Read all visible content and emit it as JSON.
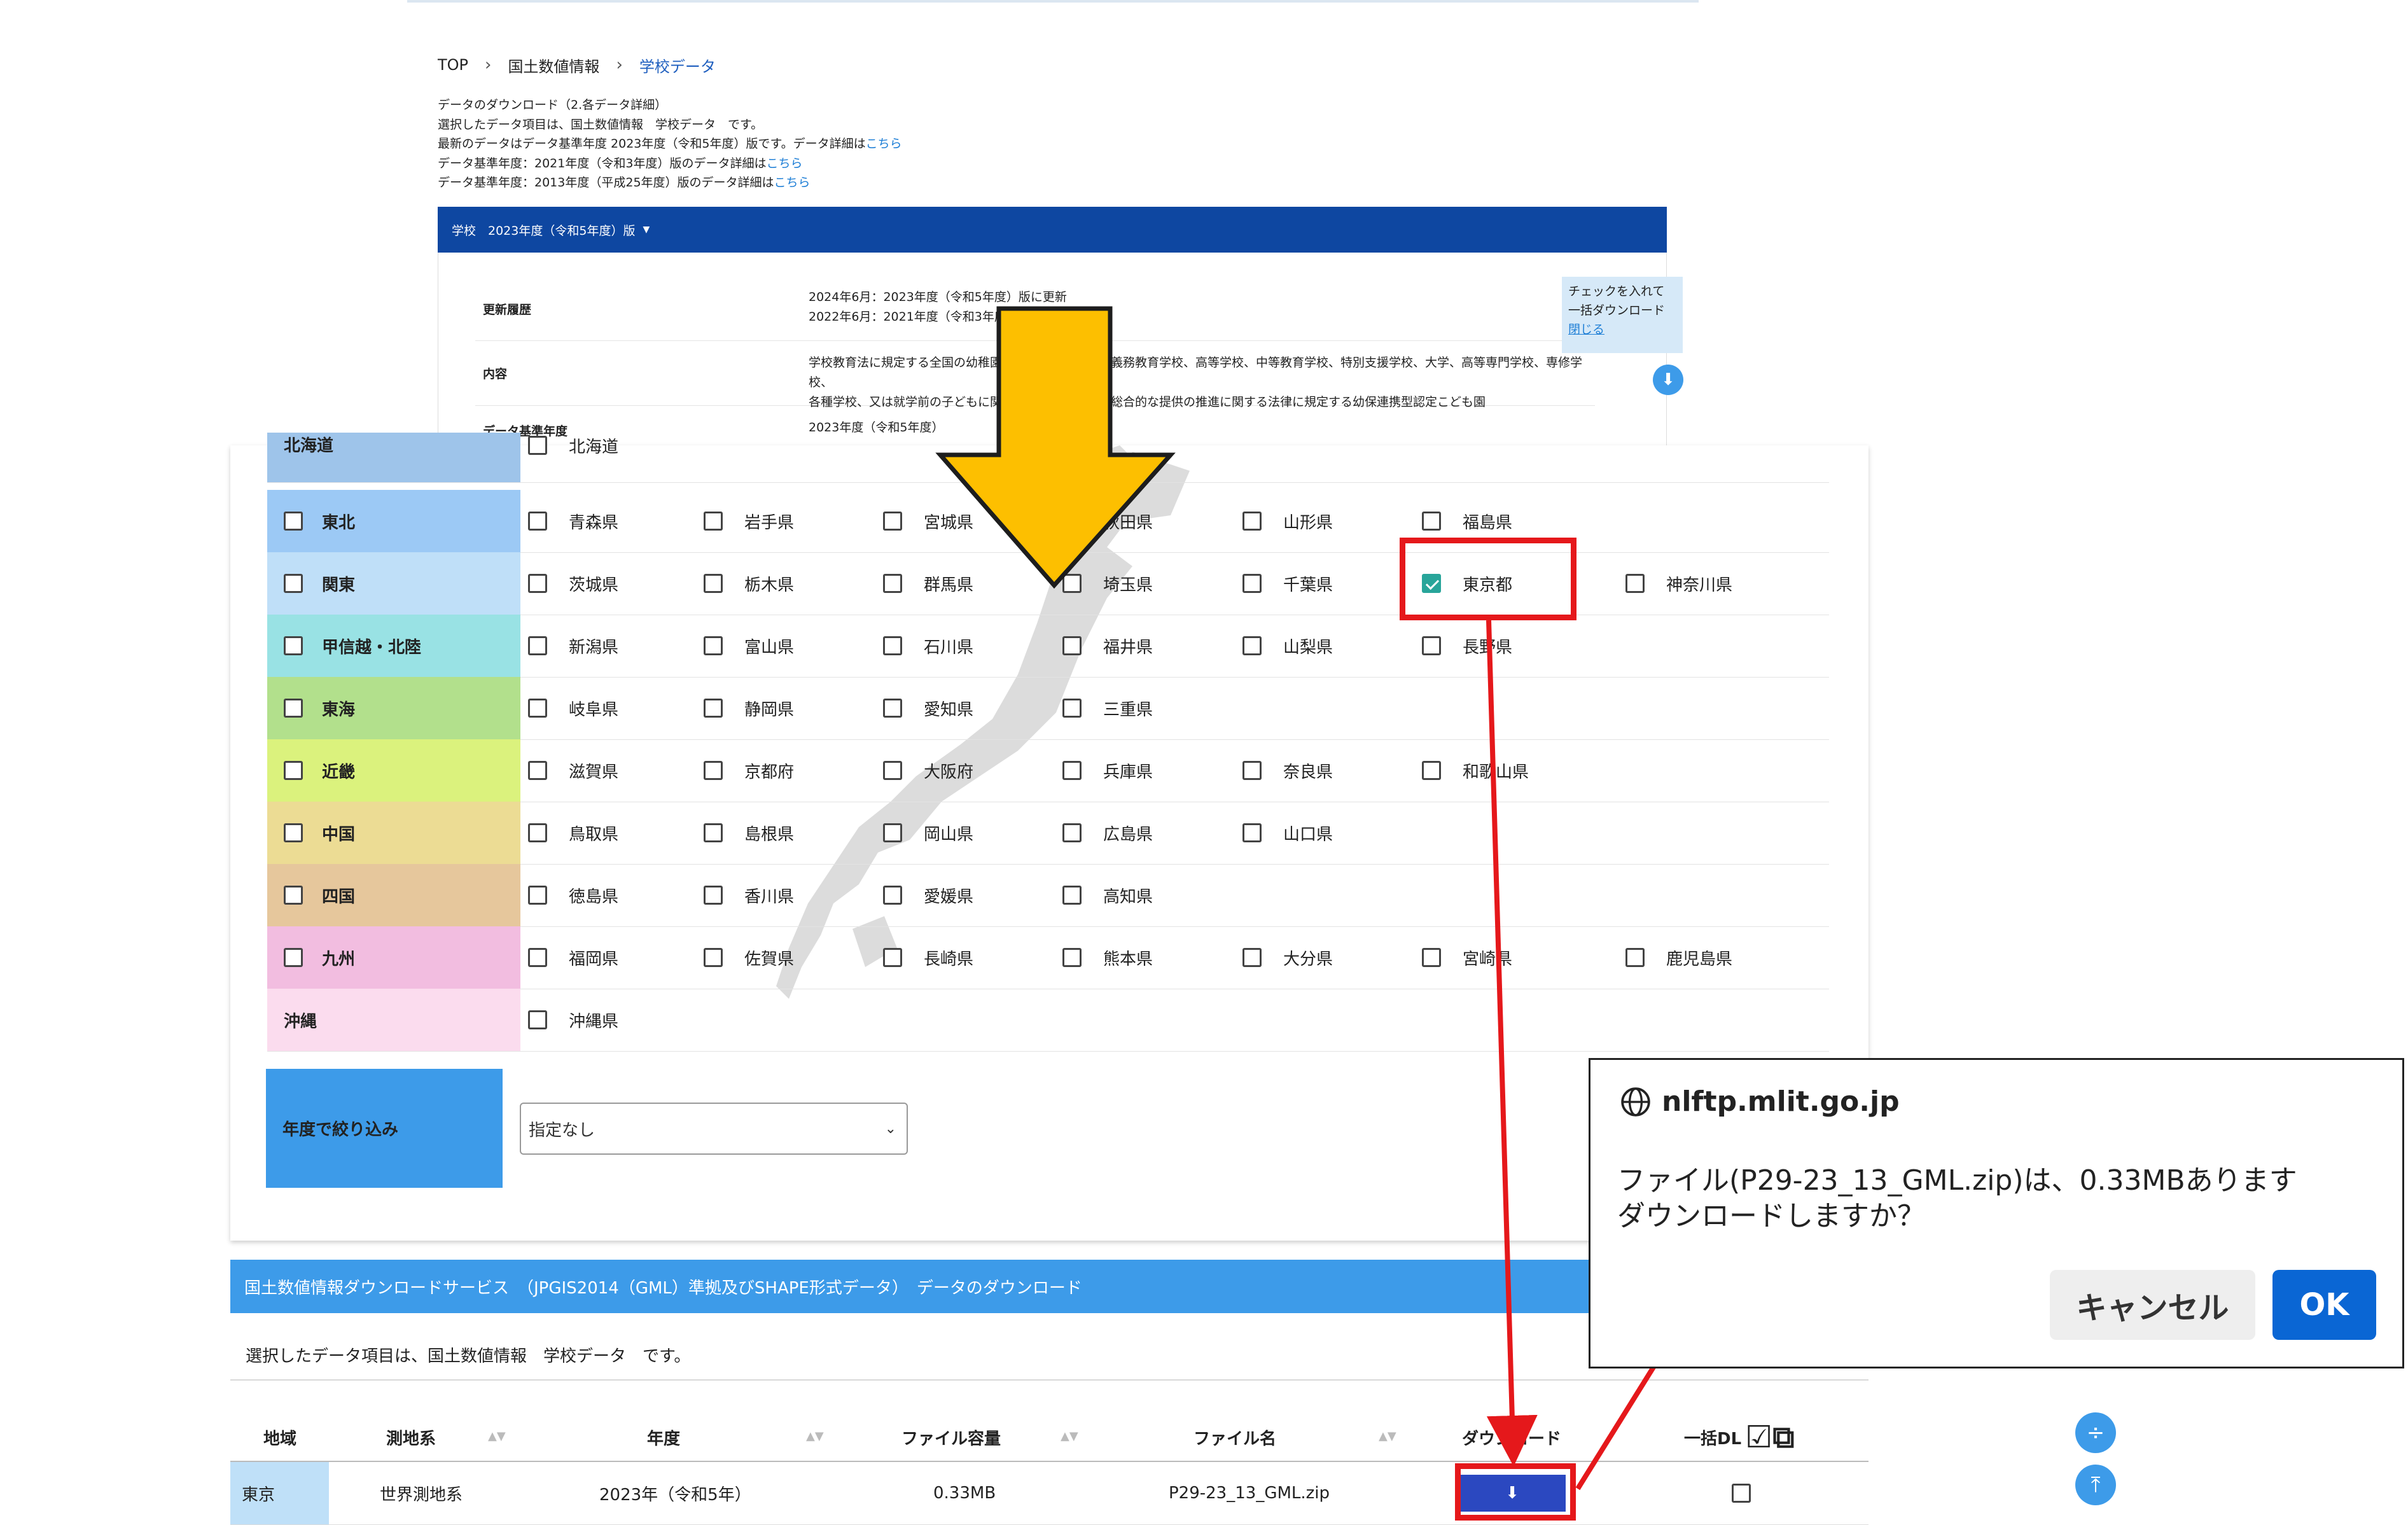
{
  "breadcrumb": {
    "items": [
      "TOP",
      "国土数値情報",
      "学校データ"
    ],
    "separator": "›"
  },
  "intro": {
    "lines": [
      "データのダウンロード（2.各データ詳細）",
      "選択したデータ項目は、国土数値情報　学校データ　です。",
      "最新のデータはデータ基準年度 2023年度（令和5年度）版です。データ詳細は",
      "データ基準年度：2021年度（令和3年度）版のデータ詳細は",
      "データ基準年度：2013年度（平成25年度）版のデータ詳細は"
    ],
    "link": "こちら"
  },
  "version_bar": {
    "label": "学校　2023年度（令和5年度）版"
  },
  "info": {
    "history_label": "更新履歴",
    "history_lines": [
      "2024年6月：2023年度（令和5年度）版に更新",
      "2022年6月：2021年度（令和3年度）版"
    ],
    "content_label": "内容",
    "content_lines": [
      "学校教育法に規定する全国の幼稚園、小学校、中学校、義務教育学校、高等学校、中等教育学校、特別支援学校、大学、高等専門学校、専修学校、",
      "各種学校、又は就学前の子どもに関する教育、保育等の総合的な提供の推進に関する法律に規定する幼保連携型認定こども園"
    ],
    "base_year_label": "データ基準年度",
    "base_year_value": "2023年度（令和5年度）"
  },
  "bulk_tip": {
    "line1": "チェックを入れて",
    "line2": "一括ダウンロード",
    "close": "閉じる"
  },
  "regions": [
    {
      "name": "北海道",
      "color": "#9ec4ea",
      "checkbox": false,
      "prefs": [
        {
          "name": "北海道",
          "checked": false
        }
      ]
    },
    {
      "name": "東北",
      "color": "#9cc9f5",
      "checkbox": true,
      "prefs": [
        {
          "name": "青森県",
          "checked": false
        },
        {
          "name": "岩手県",
          "checked": false
        },
        {
          "name": "宮城県",
          "checked": false
        },
        {
          "name": "秋田県",
          "checked": false
        },
        {
          "name": "山形県",
          "checked": false
        },
        {
          "name": "福島県",
          "checked": false
        }
      ]
    },
    {
      "name": "関東",
      "color": "#bfdff8",
      "checkbox": true,
      "prefs": [
        {
          "name": "茨城県",
          "checked": false
        },
        {
          "name": "栃木県",
          "checked": false
        },
        {
          "name": "群馬県",
          "checked": false
        },
        {
          "name": "埼玉県",
          "checked": false
        },
        {
          "name": "千葉県",
          "checked": false
        },
        {
          "name": "東京都",
          "checked": true
        },
        {
          "name": "神奈川県",
          "checked": false
        }
      ]
    },
    {
      "name": "甲信越・北陸",
      "color": "#99e2e4",
      "checkbox": true,
      "prefs": [
        {
          "name": "新潟県",
          "checked": false
        },
        {
          "name": "富山県",
          "checked": false
        },
        {
          "name": "石川県",
          "checked": false
        },
        {
          "name": "福井県",
          "checked": false
        },
        {
          "name": "山梨県",
          "checked": false
        },
        {
          "name": "長野県",
          "checked": false
        }
      ]
    },
    {
      "name": "東海",
      "color": "#b2e08c",
      "checkbox": true,
      "prefs": [
        {
          "name": "岐阜県",
          "checked": false
        },
        {
          "name": "静岡県",
          "checked": false
        },
        {
          "name": "愛知県",
          "checked": false
        },
        {
          "name": "三重県",
          "checked": false
        }
      ]
    },
    {
      "name": "近畿",
      "color": "#dbf27d",
      "checkbox": true,
      "prefs": [
        {
          "name": "滋賀県",
          "checked": false
        },
        {
          "name": "京都府",
          "checked": false
        },
        {
          "name": "大阪府",
          "checked": false
        },
        {
          "name": "兵庫県",
          "checked": false
        },
        {
          "name": "奈良県",
          "checked": false
        },
        {
          "name": "和歌山県",
          "checked": false
        }
      ]
    },
    {
      "name": "中国",
      "color": "#ecdc94",
      "checkbox": true,
      "prefs": [
        {
          "name": "鳥取県",
          "checked": false
        },
        {
          "name": "島根県",
          "checked": false
        },
        {
          "name": "岡山県",
          "checked": false
        },
        {
          "name": "広島県",
          "checked": false
        },
        {
          "name": "山口県",
          "checked": false
        }
      ]
    },
    {
      "name": "四国",
      "color": "#e6c79c",
      "checkbox": true,
      "prefs": [
        {
          "name": "徳島県",
          "checked": false
        },
        {
          "name": "香川県",
          "checked": false
        },
        {
          "name": "愛媛県",
          "checked": false
        },
        {
          "name": "高知県",
          "checked": false
        }
      ]
    },
    {
      "name": "九州",
      "color": "#f2bde0",
      "checkbox": true,
      "prefs": [
        {
          "name": "福岡県",
          "checked": false
        },
        {
          "name": "佐賀県",
          "checked": false
        },
        {
          "name": "長崎県",
          "checked": false
        },
        {
          "name": "熊本県",
          "checked": false
        },
        {
          "name": "大分県",
          "checked": false
        },
        {
          "name": "宮崎県",
          "checked": false
        },
        {
          "name": "鹿児島県",
          "checked": false
        }
      ]
    },
    {
      "name": "沖縄",
      "color": "#fbdcee",
      "checkbox": false,
      "prefs": [
        {
          "name": "沖縄県",
          "checked": false
        }
      ]
    }
  ],
  "year_filter": {
    "label": "年度で絞り込み",
    "value": "指定なし"
  },
  "download": {
    "title": "国土数値情報ダウンロードサービス　（JPGIS2014（GML）準拠及びSHAPE形式データ）　データのダウンロード",
    "subtitle": "選択したデータ項目は、国土数値情報　学校データ　です。",
    "headers": {
      "region": "地域",
      "datum": "測地系",
      "year": "年度",
      "size": "ファイル容量",
      "filename": "ファイル名",
      "download": "ダウンロード",
      "bulk": "一括DL"
    },
    "row": {
      "region": "東京",
      "datum": "世界測地系",
      "year": "2023年（令和5年）",
      "size": "0.33MB",
      "filename": "P29-23_13_GML.zip"
    }
  },
  "dialog": {
    "host": "nlftp.mlit.go.jp",
    "message_line1": "ファイル(P29-23_13_GML.zip)は、0.33MBあります",
    "message_line2": "ダウンロードしますか？",
    "cancel": "キャンセル",
    "ok": "OK"
  },
  "colors": {
    "accent": "#3d9be9",
    "navy": "#0e47a1",
    "annotation_red": "#e5181b",
    "arrow_yellow": "#fdbf00",
    "ok_blue": "#0a66d4"
  }
}
